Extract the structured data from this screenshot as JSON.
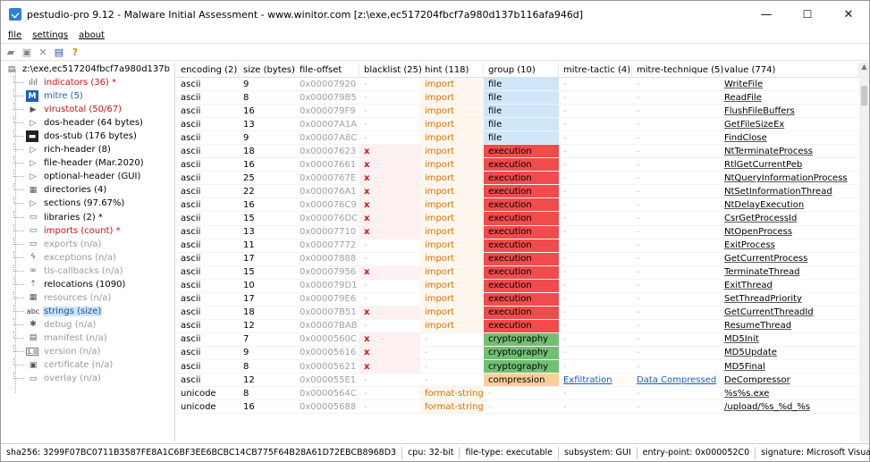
{
  "window": {
    "title": "pestudio-pro 9.12 - Malware Initial Assessment - www.winitor.com [z:\\exe,ec517204fbcf7a980d137b116afa946d]",
    "minimize": "—",
    "maximize": "☐",
    "close": "✕"
  },
  "menu": [
    "file",
    "settings",
    "about"
  ],
  "tree": [
    {
      "label": "z:\\exe,ec517204fbcf7a980d137b",
      "style": "black",
      "icon": "file-root-icon",
      "glyph": "▤",
      "indent": 0
    },
    {
      "label": "indicators (36) *",
      "style": "red",
      "icon": "indicators-icon",
      "glyph": "ılıl",
      "indent": 1
    },
    {
      "label": "mitre (5)",
      "style": "blue",
      "icon": "mitre-icon",
      "glyph": "M",
      "indent": 1
    },
    {
      "label": "virustotal (50/67)",
      "style": "red",
      "icon": "virustotal-icon",
      "glyph": "▶",
      "indent": 1
    },
    {
      "label": "dos-header (64 bytes)",
      "style": "black",
      "icon": "expand-icon",
      "glyph": "▷",
      "indent": 1
    },
    {
      "label": "dos-stub (176 bytes)",
      "style": "black",
      "icon": "dos-stub-icon",
      "glyph": "▬",
      "indent": 1
    },
    {
      "label": "rich-header (8)",
      "style": "black",
      "icon": "expand-icon",
      "glyph": "▷",
      "indent": 1
    },
    {
      "label": "file-header (Mar.2020)",
      "style": "black",
      "icon": "expand-icon",
      "glyph": "▷",
      "indent": 1
    },
    {
      "label": "optional-header (GUI)",
      "style": "black",
      "icon": "expand-icon",
      "glyph": "▷",
      "indent": 1
    },
    {
      "label": "directories (4)",
      "style": "black",
      "icon": "directories-icon",
      "glyph": "▦",
      "indent": 1
    },
    {
      "label": "sections (97.67%)",
      "style": "black",
      "icon": "expand-icon",
      "glyph": "▷",
      "indent": 1
    },
    {
      "label": "libraries (2) *",
      "style": "black",
      "icon": "libraries-icon",
      "glyph": "▭",
      "indent": 1
    },
    {
      "label": "imports (count) *",
      "style": "red",
      "icon": "imports-icon",
      "glyph": "▭",
      "indent": 1
    },
    {
      "label": "exports (n/a)",
      "style": "gray",
      "icon": "exports-icon",
      "glyph": "▭",
      "indent": 1
    },
    {
      "label": "exceptions (n/a)",
      "style": "gray",
      "icon": "exceptions-icon",
      "glyph": "ϟ",
      "indent": 1
    },
    {
      "label": "tls-callbacks (n/a)",
      "style": "gray",
      "icon": "tls-callbacks-icon",
      "glyph": "∞",
      "indent": 1
    },
    {
      "label": "relocations (1090)",
      "style": "black",
      "icon": "relocations-icon",
      "glyph": "⇡",
      "indent": 1
    },
    {
      "label": "resources (n/a)",
      "style": "gray",
      "icon": "resources-icon",
      "glyph": "▦",
      "indent": 1
    },
    {
      "label": "strings (size)",
      "style": "sel",
      "icon": "strings-icon",
      "glyph": "abc",
      "indent": 1
    },
    {
      "label": "debug (n/a)",
      "style": "gray",
      "icon": "debug-icon",
      "glyph": "✱",
      "indent": 1
    },
    {
      "label": "manifest (n/a)",
      "style": "gray",
      "icon": "manifest-icon",
      "glyph": "▤",
      "indent": 1
    },
    {
      "label": "version (n/a)",
      "style": "gray",
      "icon": "version-icon",
      "glyph": "1.0",
      "indent": 1
    },
    {
      "label": "certificate (n/a)",
      "style": "gray",
      "icon": "certificate-icon",
      "glyph": "▣",
      "indent": 1
    },
    {
      "label": "overlay (n/a)",
      "style": "gray",
      "icon": "overlay-icon",
      "glyph": "▭",
      "indent": 1
    }
  ],
  "columns": [
    "encoding (2)",
    "size (bytes)",
    "file-offset",
    "blacklist (25)",
    "hint (118)",
    "group (10)",
    "mitre-tactic (4)",
    "mitre-technique (5)",
    "value (774)"
  ],
  "rows": [
    [
      "ascii",
      "9",
      "0x00007920",
      "-",
      "import",
      "file",
      "-",
      "-",
      "WriteFile"
    ],
    [
      "ascii",
      "8",
      "0x000079B5",
      "-",
      "import",
      "file",
      "-",
      "-",
      "ReadFile"
    ],
    [
      "ascii",
      "16",
      "0x000079F9",
      "-",
      "import",
      "file",
      "-",
      "-",
      "FlushFileBuffers"
    ],
    [
      "ascii",
      "13",
      "0x00007A1A",
      "-",
      "import",
      "file",
      "-",
      "-",
      "GetFileSizeEx"
    ],
    [
      "ascii",
      "9",
      "0x00007A8C",
      "-",
      "import",
      "file",
      "-",
      "-",
      "FindClose"
    ],
    [
      "ascii",
      "18",
      "0x00007623",
      "x",
      "import",
      "execution",
      "-",
      "-",
      "NtTerminateProcess"
    ],
    [
      "ascii",
      "16",
      "0x00007661",
      "x",
      "import",
      "execution",
      "-",
      "-",
      "RtlGetCurrentPeb"
    ],
    [
      "ascii",
      "25",
      "0x0000767E",
      "x",
      "import",
      "execution",
      "-",
      "-",
      "NtQueryInformationProcess"
    ],
    [
      "ascii",
      "22",
      "0x000076A1",
      "x",
      "import",
      "execution",
      "-",
      "-",
      "NtSetInformationThread"
    ],
    [
      "ascii",
      "16",
      "0x000076C9",
      "x",
      "import",
      "execution",
      "-",
      "-",
      "NtDelayExecution"
    ],
    [
      "ascii",
      "15",
      "0x000076DC",
      "x",
      "import",
      "execution",
      "-",
      "-",
      "CsrGetProcessId"
    ],
    [
      "ascii",
      "13",
      "0x00007710",
      "x",
      "import",
      "execution",
      "-",
      "-",
      "NtOpenProcess"
    ],
    [
      "ascii",
      "11",
      "0x00007772",
      "-",
      "import",
      "execution",
      "-",
      "-",
      "ExitProcess"
    ],
    [
      "ascii",
      "17",
      "0x00007888",
      "-",
      "import",
      "execution",
      "-",
      "-",
      "GetCurrentProcess"
    ],
    [
      "ascii",
      "15",
      "0x00007956",
      "x",
      "import",
      "execution",
      "-",
      "-",
      "TerminateThread"
    ],
    [
      "ascii",
      "10",
      "0x000079D1",
      "-",
      "import",
      "execution",
      "-",
      "-",
      "ExitThread"
    ],
    [
      "ascii",
      "17",
      "0x000079E6",
      "-",
      "import",
      "execution",
      "-",
      "-",
      "SetThreadPriority"
    ],
    [
      "ascii",
      "18",
      "0x00007B51",
      "x",
      "import",
      "execution",
      "-",
      "-",
      "GetCurrentThreadId"
    ],
    [
      "ascii",
      "12",
      "0x00007BAB",
      "-",
      "import",
      "execution",
      "-",
      "-",
      "ResumeThread"
    ],
    [
      "ascii",
      "7",
      "0x0000560C",
      "x",
      "-",
      "cryptography",
      "-",
      "-",
      "MD5Init"
    ],
    [
      "ascii",
      "9",
      "0x00005616",
      "x",
      "-",
      "cryptography",
      "-",
      "-",
      "MD5Update"
    ],
    [
      "ascii",
      "8",
      "0x00005621",
      "x",
      "-",
      "cryptography",
      "-",
      "-",
      "MD5Final"
    ],
    [
      "ascii",
      "12",
      "0x000055E1",
      "-",
      "-",
      "compression",
      "Exfiltration",
      "Data Compressed",
      "DeCompressor"
    ],
    [
      "unicode",
      "8",
      "0x0000564C",
      "-",
      "format-string",
      "-",
      "-",
      "-",
      "%s%s.exe"
    ],
    [
      "unicode",
      "16",
      "0x00005688",
      "-",
      "format-string",
      "-",
      "-",
      "-",
      "/upload/%s_%d_%s"
    ]
  ],
  "status": [
    "sha256: 3299F07BC0711B3587FE8A1C6BF3EE6BCBC14CB775F64B28A61D72EBCB8968D3",
    "cpu: 32-bit",
    "file-type: executable",
    "subsystem: GUI",
    "entry-point: 0x000052C0",
    "signature: Microsoft Visual C++"
  ],
  "colors": {
    "execution": "#f14b4b",
    "file": "#cfe6f8",
    "cryptography": "#72bf72",
    "compression": "#fbcf9a"
  }
}
